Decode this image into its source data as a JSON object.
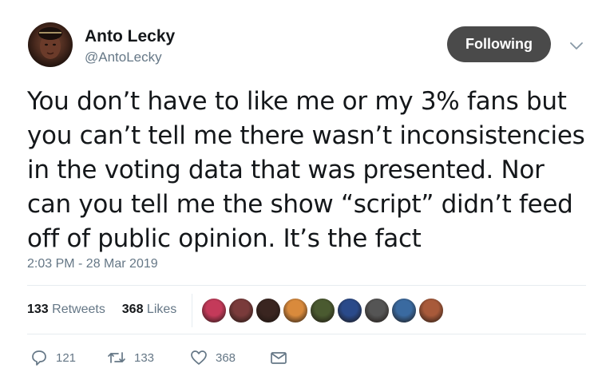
{
  "author": {
    "name": "Anto Lecky",
    "handle": "@AntoLecky"
  },
  "follow_button": {
    "label": "Following"
  },
  "tweet": {
    "text": "You don’t have to like me or my 3% fans but\nyou can’t tell me there wasn’t inconsistencies\nin the voting data that was presented. Nor\ncan you tell me the show “script” didn’t feed\noff of public opinion. It’s the fact",
    "timestamp": "2:03 PM - 28 Mar 2019"
  },
  "stats": {
    "retweets_count": "133",
    "retweets_label": "Retweets",
    "likes_count": "368",
    "likes_label": "Likes"
  },
  "likers": [
    {
      "icon": "liker-avatar",
      "color": "#c43a5a"
    },
    {
      "icon": "liker-avatar",
      "color": "#7a3b3b"
    },
    {
      "icon": "liker-avatar",
      "color": "#3a2520"
    },
    {
      "icon": "liker-avatar",
      "color": "#d98a3c"
    },
    {
      "icon": "liker-avatar",
      "color": "#4a5a30"
    },
    {
      "icon": "liker-avatar",
      "color": "#2a4a8a"
    },
    {
      "icon": "liker-avatar",
      "color": "#555555"
    },
    {
      "icon": "liker-avatar",
      "color": "#3a6aa0"
    },
    {
      "icon": "liker-avatar",
      "color": "#a85a3a"
    }
  ],
  "actions": {
    "reply_count": "121",
    "retweet_count": "133",
    "like_count": "368"
  },
  "colors": {
    "text": "#14171a",
    "secondary": "#657786",
    "button_bg": "#4a4a4a",
    "divider": "#e6ecf0"
  }
}
